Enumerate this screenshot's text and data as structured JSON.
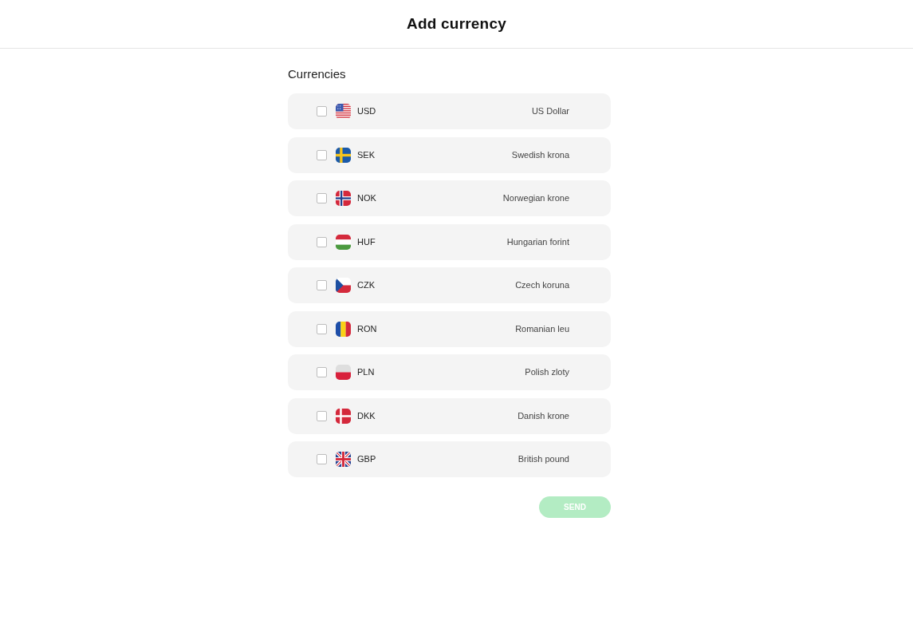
{
  "header": {
    "title": "Add currency"
  },
  "section_title": "Currencies",
  "currencies": [
    {
      "kind": "usa",
      "code": "USD",
      "name": "US Dollar",
      "checked": false
    },
    {
      "kind": "sweden",
      "code": "SEK",
      "name": "Swedish krona",
      "checked": false
    },
    {
      "kind": "norway",
      "code": "NOK",
      "name": "Norwegian krone",
      "checked": false
    },
    {
      "kind": "hungary",
      "code": "HUF",
      "name": "Hungarian forint",
      "checked": false
    },
    {
      "kind": "czechia",
      "code": "CZK",
      "name": "Czech koruna",
      "checked": false
    },
    {
      "kind": "romania",
      "code": "RON",
      "name": "Romanian leu",
      "checked": false
    },
    {
      "kind": "poland",
      "code": "PLN",
      "name": "Polish zloty",
      "checked": false
    },
    {
      "kind": "denmark",
      "code": "DKK",
      "name": "Danish krone",
      "checked": false
    },
    {
      "kind": "uk",
      "code": "GBP",
      "name": "British pound",
      "checked": false
    }
  ],
  "send_button": {
    "label": "SEND",
    "disabled": true
  }
}
